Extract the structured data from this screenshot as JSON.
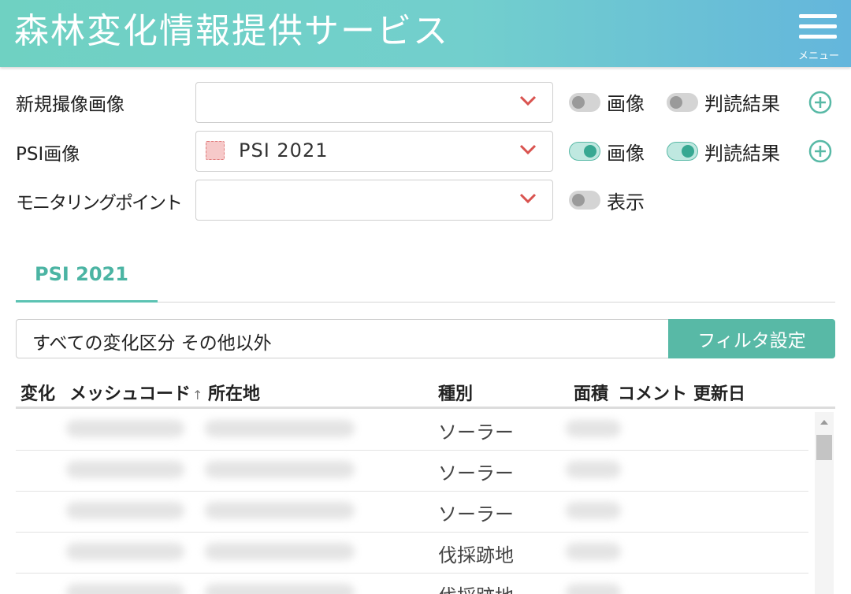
{
  "header": {
    "title": "森林変化情報提供サービス",
    "menu_label": "メニュー",
    "menu_icon": "hamburger-icon"
  },
  "layers": {
    "new_image": {
      "label": "新規撮像画像",
      "selected": "",
      "toggle_image": {
        "label": "画像",
        "on": false
      },
      "toggle_result": {
        "label": "判読結果",
        "on": false
      }
    },
    "psi_image": {
      "label": "PSI画像",
      "selected": "PSI 2021",
      "toggle_image": {
        "label": "画像",
        "on": true
      },
      "toggle_result": {
        "label": "判読結果",
        "on": true
      }
    },
    "monitoring": {
      "label": "モニタリングポイント",
      "selected": "",
      "toggle_show": {
        "label": "表示",
        "on": false
      }
    }
  },
  "tabs": [
    {
      "label": "PSI 2021",
      "active": true
    }
  ],
  "filter": {
    "text": "すべての変化区分 その他以外",
    "button_label": "フィルタ設定"
  },
  "table": {
    "columns": [
      "変化",
      "メッシュコード",
      "所在地",
      "種別",
      "面積",
      "コメント",
      "更新日"
    ],
    "rows": [
      {
        "type": "ソーラー"
      },
      {
        "type": "ソーラー"
      },
      {
        "type": "ソーラー"
      },
      {
        "type": "伐採跡地"
      },
      {
        "type": "伐採跡地"
      }
    ]
  },
  "colors": {
    "accent": "#58b9a6",
    "chevron": "#d9534f",
    "header_start": "#6fd1c2",
    "header_end": "#64b6dc"
  }
}
